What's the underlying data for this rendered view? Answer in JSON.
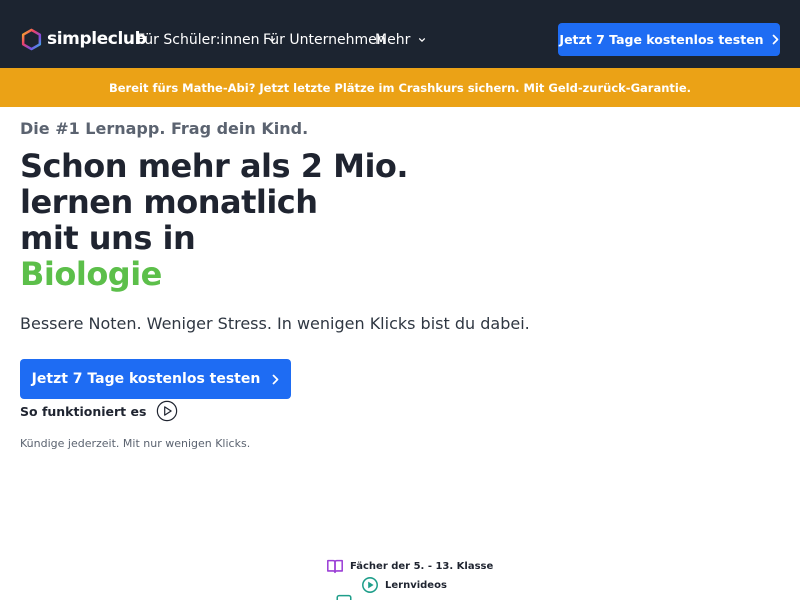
{
  "header": {
    "brand": "simpleclub",
    "nav": [
      {
        "label": "Für Schüler:innen",
        "has_dropdown": true
      },
      {
        "label": "Für Unternehmen",
        "has_dropdown": false
      },
      {
        "label": "Mehr",
        "has_dropdown": true
      }
    ],
    "cta_label": "Jetzt 7 Tage kostenlos testen",
    "background": "#1c2430",
    "accent": "#1e6cf3"
  },
  "banner": {
    "text": "Bereit fürs Mathe-Abi? Jetzt letzte Plätze im Crashkurs sichern. Mit Geld-zurück-Garantie.",
    "background": "#eba216"
  },
  "hero": {
    "eyebrow": "Die #1 Lernapp. Frag dein Kind.",
    "headline_lines": [
      "Schon mehr als 2 Mio.",
      "lernen monatlich",
      "mit uns in"
    ],
    "headline_accent": "Biologie",
    "accent_color": "#5cbf4a",
    "subline": "Bessere Noten. Weniger Stress. In wenigen Klicks bist du dabei.",
    "cta_label": "Jetzt 7 Tage kostenlos testen",
    "how_it_works": "So funktioniert es",
    "cancel_note": "Kündige jederzeit. Mit nur wenigen Klicks."
  },
  "features": [
    {
      "label": "Fächer der 5. - 13. Klasse",
      "icon": "book-icon",
      "color": "#9b3fd6"
    },
    {
      "label": "Lernvideos",
      "icon": "play-circle-icon",
      "color": "#1f9e8a"
    },
    {
      "label": "",
      "icon": "chat-icon",
      "color": "#1f9e8a"
    }
  ]
}
